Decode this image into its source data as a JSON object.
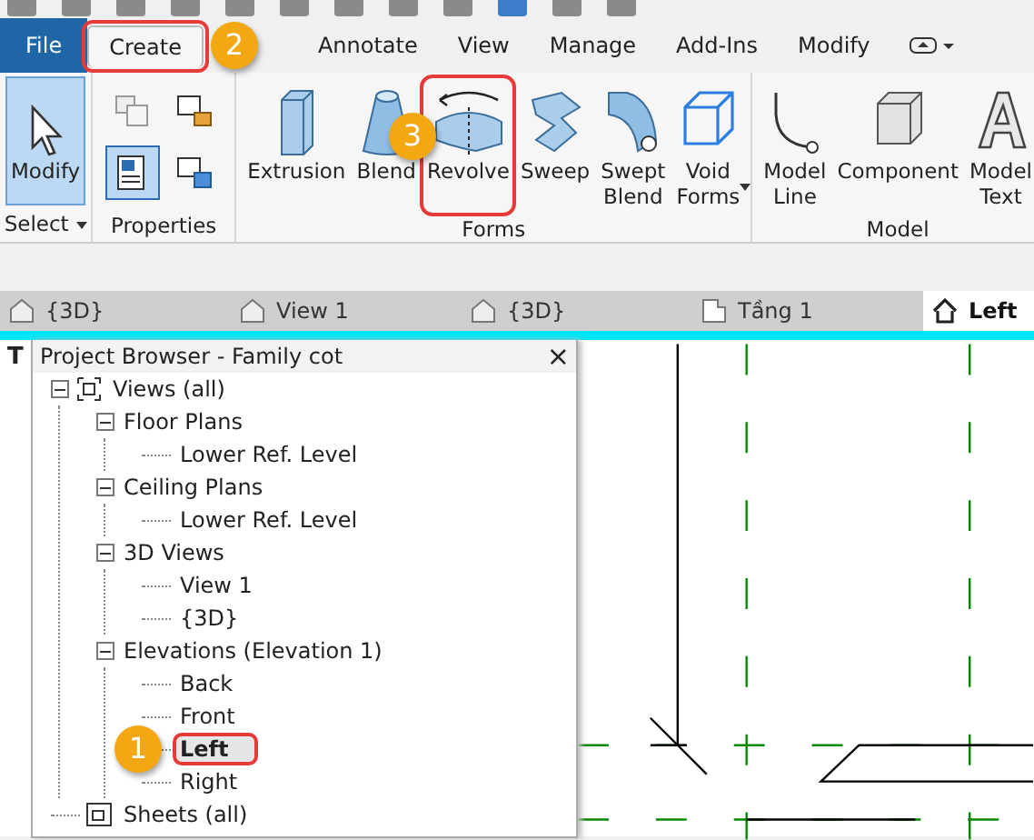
{
  "ribbon_tabs": [
    {
      "label": "File",
      "kind": "file",
      "selected": false
    },
    {
      "label": "Create",
      "kind": "tab",
      "selected": true,
      "highlighted": true,
      "callout": "2"
    },
    {
      "label": "Annotate",
      "kind": "tab",
      "selected": false
    },
    {
      "label": "View",
      "kind": "tab",
      "selected": false
    },
    {
      "label": "Manage",
      "kind": "tab",
      "selected": false
    },
    {
      "label": "Add-Ins",
      "kind": "tab",
      "selected": false
    },
    {
      "label": "Modify",
      "kind": "tab",
      "selected": false
    }
  ],
  "ribbon_panels": [
    {
      "label": "Select",
      "dropdown": true,
      "tools": [
        {
          "label": "Modify",
          "selected": true
        }
      ]
    },
    {
      "label": "Properties",
      "small_tools": [
        {
          "selected": false
        },
        {
          "selected": false
        },
        {
          "selected": true
        },
        {
          "selected": false
        }
      ]
    },
    {
      "label": "Forms",
      "tools": [
        {
          "label": "Extrusion",
          "selected": false
        },
        {
          "label": "Blend",
          "selected": false
        },
        {
          "label": "Revolve",
          "selected": false,
          "highlighted": true,
          "callout": "3"
        },
        {
          "label": "Sweep",
          "selected": false
        },
        {
          "label": "Swept\nBlend",
          "selected": false
        },
        {
          "label": "Void\nForms",
          "selected": false,
          "dropdown": true
        }
      ]
    },
    {
      "label": "Model",
      "tools": [
        {
          "label": "Model\nLine",
          "selected": false
        },
        {
          "label": "Component",
          "selected": false
        },
        {
          "label": "Model\nText",
          "selected": false
        }
      ]
    }
  ],
  "view_tabs": [
    {
      "label": "{3D}",
      "kind": "model",
      "selected": false
    },
    {
      "label": "View 1",
      "kind": "model",
      "selected": false
    },
    {
      "label": "{3D}",
      "kind": "model",
      "selected": false
    },
    {
      "label": "Tầng 1",
      "kind": "plan",
      "selected": false
    },
    {
      "label": "Left",
      "kind": "elevation",
      "selected": true
    }
  ],
  "view_edge_text": "T",
  "project_browser": {
    "title": "Project Browser - Family cot",
    "close": "×",
    "tree": [
      {
        "label": "Views (all)",
        "kind": "views",
        "expanded": true,
        "children": [
          {
            "label": "Floor Plans",
            "expanded": true,
            "children": [
              {
                "label": "Lower Ref. Level",
                "selected": false
              }
            ]
          },
          {
            "label": "Ceiling Plans",
            "expanded": true,
            "children": [
              {
                "label": "Lower Ref. Level",
                "selected": false
              }
            ]
          },
          {
            "label": "3D Views",
            "expanded": true,
            "children": [
              {
                "label": "View 1",
                "selected": false
              },
              {
                "label": "{3D}",
                "selected": false
              }
            ]
          },
          {
            "label": "Elevations (Elevation 1)",
            "expanded": true,
            "children": [
              {
                "label": "Back",
                "selected": false
              },
              {
                "label": "Front",
                "selected": false
              },
              {
                "label": "Left",
                "selected": true,
                "highlighted": true,
                "callout": "1"
              },
              {
                "label": "Right",
                "selected": false
              }
            ]
          }
        ]
      },
      {
        "label": "Sheets (all)",
        "kind": "sheets"
      }
    ]
  }
}
